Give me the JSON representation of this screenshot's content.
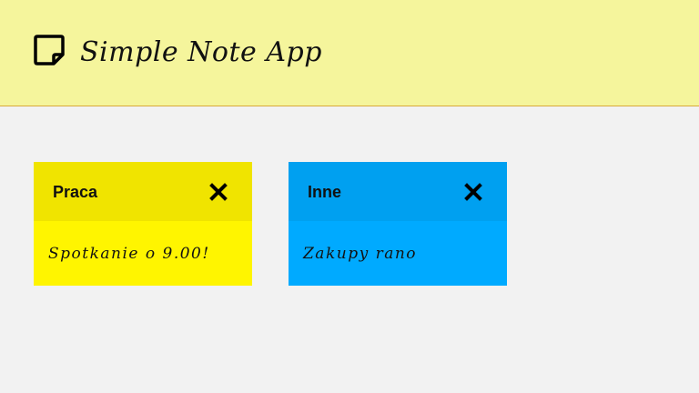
{
  "app": {
    "title": "Simple Note App",
    "icon": "sticky-note-icon"
  },
  "colors": {
    "header_bg": "#f5f59c",
    "page_bg": "#f2f2f2"
  },
  "notes": [
    {
      "title": "Praca",
      "text": "Spotkanie o 9.00!",
      "close_icon": "close-icon",
      "header_color": "#f0e400",
      "body_color": "#fff500"
    },
    {
      "title": "Inne",
      "text": "Zakupy rano",
      "close_icon": "close-icon",
      "header_color": "#00a0f0",
      "body_color": "#00aaff"
    }
  ]
}
